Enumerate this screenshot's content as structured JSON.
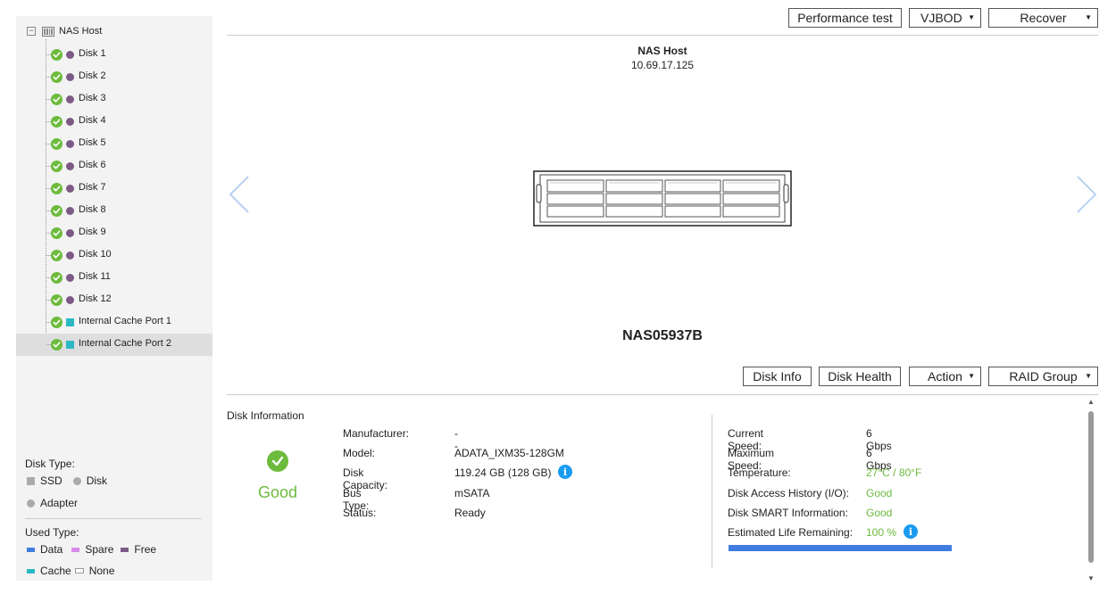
{
  "tree": {
    "root_label": "NAS Host",
    "items": [
      {
        "label": "Disk 1",
        "kind": "disk"
      },
      {
        "label": "Disk 2",
        "kind": "disk"
      },
      {
        "label": "Disk 3",
        "kind": "disk"
      },
      {
        "label": "Disk 4",
        "kind": "disk"
      },
      {
        "label": "Disk 5",
        "kind": "disk"
      },
      {
        "label": "Disk 6",
        "kind": "disk"
      },
      {
        "label": "Disk 7",
        "kind": "disk"
      },
      {
        "label": "Disk 8",
        "kind": "disk"
      },
      {
        "label": "Disk 9",
        "kind": "disk"
      },
      {
        "label": "Disk 10",
        "kind": "disk"
      },
      {
        "label": "Disk 11",
        "kind": "disk"
      },
      {
        "label": "Disk 12",
        "kind": "disk"
      },
      {
        "label": "Internal Cache Port 1",
        "kind": "cache"
      },
      {
        "label": "Internal Cache Port 2",
        "kind": "cache",
        "selected": true
      }
    ]
  },
  "legend": {
    "disk_type_title": "Disk Type:",
    "ssd": "SSD",
    "disk": "Disk",
    "adapter": "Adapter",
    "used_type_title": "Used Type:",
    "data": "Data",
    "spare": "Spare",
    "free": "Free",
    "cache": "Cache",
    "none": "None",
    "colors": {
      "data": "#3f7de0",
      "spare": "#d98be8",
      "free": "#7d5a86",
      "cache": "#2bb8c5",
      "ssd": "#aaaaaa",
      "disk": "#aaaaaa"
    }
  },
  "toolbar": {
    "performance_test": "Performance test",
    "vjbod": "VJBOD",
    "recover": "Recover"
  },
  "enclosure": {
    "host_name": "NAS Host",
    "host_ip": "10.69.17.125",
    "name": "NAS05937B"
  },
  "disk_toolbar": {
    "disk_info": "Disk Info",
    "disk_health": "Disk Health",
    "action": "Action",
    "raid_group": "RAID Group"
  },
  "disk_info": {
    "section_title": "Disk Information",
    "status_word": "Good",
    "left": [
      {
        "key": "Manufacturer:",
        "value": "--"
      },
      {
        "key": "Model:",
        "value": "ADATA_IXM35-128GM"
      },
      {
        "key": "Disk Capacity:",
        "value": "119.24 GB (128 GB)"
      },
      {
        "key": "Bus Type:",
        "value": "mSATA"
      },
      {
        "key": "Status:",
        "value": "Ready"
      }
    ],
    "right": [
      {
        "key": "Current Speed:",
        "value": "6 Gbps"
      },
      {
        "key": "Maximum Speed:",
        "value": "6 Gbps"
      },
      {
        "key": "Temperature:",
        "value": "27°C / 80°F"
      },
      {
        "key": "Disk Access History (I/O):",
        "value": "Good"
      },
      {
        "key": "Disk SMART Information:",
        "value": "Good"
      },
      {
        "key": "Estimated Life Remaining:",
        "value": "100 %"
      }
    ],
    "life_remaining_fraction": 1.0,
    "info_icon": "i"
  }
}
